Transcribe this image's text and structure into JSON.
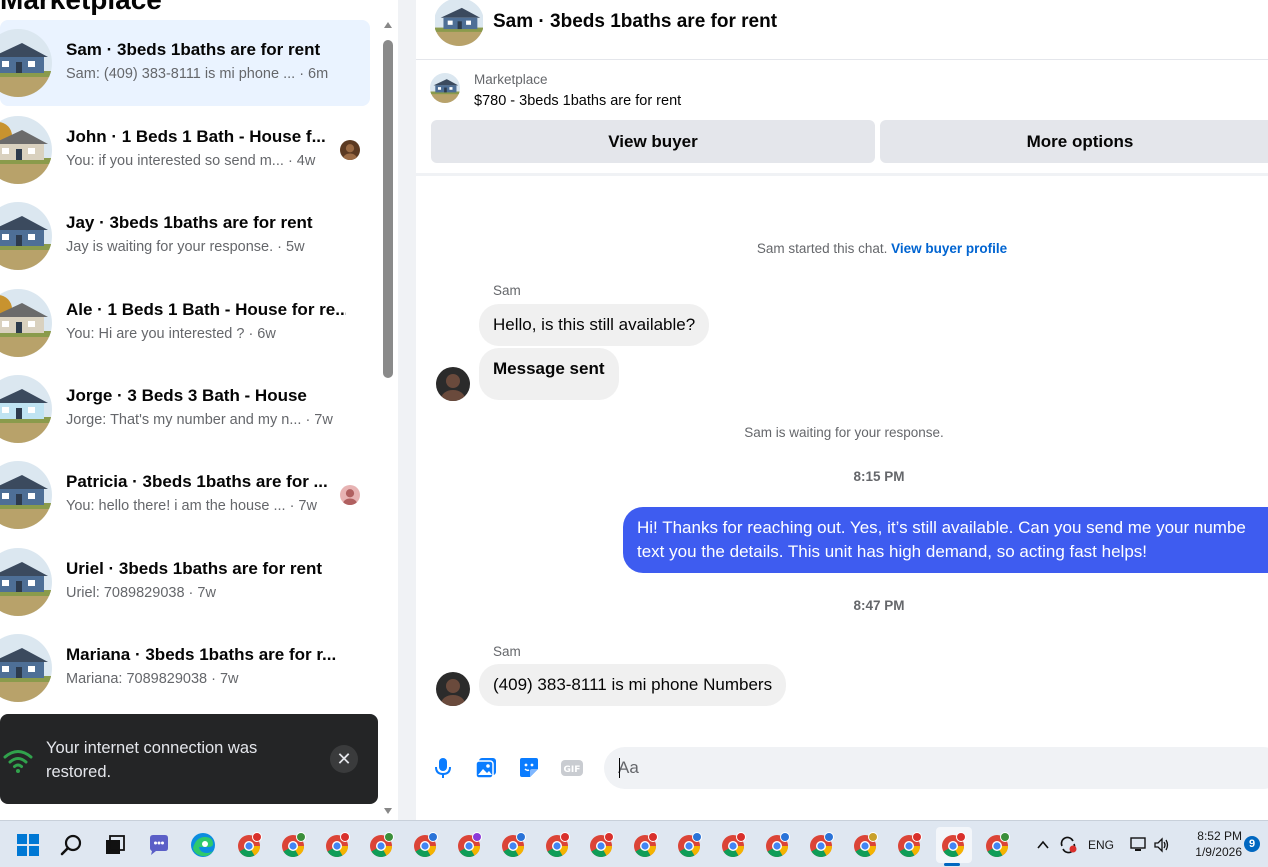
{
  "left_panel": {
    "title": "Marketplace",
    "conversations": [
      {
        "title": "Sam · 3beds 1baths are for rent",
        "preview": "Sam: (409) 383-8111 is mi phone ...",
        "time": "· 6m",
        "active": true,
        "has_avatar": false
      },
      {
        "title": "John · 1 Beds 1 Bath - House f...",
        "preview": "You: if you interested so send m...",
        "time": "· 4w",
        "active": false,
        "has_avatar": true
      },
      {
        "title": "Jay · 3beds 1baths are for rent",
        "preview": "Jay is waiting for your response.",
        "time": "· 5w",
        "active": false,
        "has_avatar": false
      },
      {
        "title": "Ale · 1 Beds 1 Bath - House for re...",
        "preview": "You: Hi are you interested ?",
        "time": "· 6w",
        "active": false,
        "has_avatar": false
      },
      {
        "title": "Jorge · 3 Beds 3 Bath - House",
        "preview": "Jorge: That's my number and my n...",
        "time": "· 7w",
        "active": false,
        "has_avatar": false
      },
      {
        "title": "Patricia · 3beds 1baths are for ...",
        "preview": "You: hello there! i am the house ...",
        "time": "· 7w",
        "active": false,
        "has_avatar": true
      },
      {
        "title": "Uriel · 3beds 1baths are for rent",
        "preview": "Uriel: 7089829038",
        "time": "· 7w",
        "active": false,
        "has_avatar": false
      },
      {
        "title": "Mariana · 3beds 1baths are for r...",
        "preview": "Mariana: 7089829038",
        "time": "· 7w",
        "active": false,
        "has_avatar": false
      }
    ],
    "toast": {
      "message": "Your internet connection was restored.",
      "close_icon": "close-icon"
    }
  },
  "chat": {
    "header_title": "Sam · 3beds 1baths are for rent",
    "listing": {
      "label": "Marketplace",
      "title": "$780 - 3beds 1baths are for rent",
      "view_buyer_label": "View buyer",
      "more_options_label": "More options"
    },
    "started_text": "Sam started this chat.",
    "view_profile_link": "View buyer profile",
    "sender_1": "Sam",
    "msg_1": "Hello, is this still available?",
    "msg_2": "Message sent",
    "waiting_text": "Sam is waiting for your response.",
    "time_1": "8:15 PM",
    "outgoing_line_1": "Hi! Thanks for reaching out. Yes, it’s still available. Can you send me your numbe",
    "outgoing_line_2": "text you the details. This unit has high demand, so acting fast helps!",
    "time_2": "8:47 PM",
    "sender_2": "Sam",
    "msg_3": "(409) 383-8111 is mi phone Numbers",
    "composer_placeholder": "Aa",
    "accent_color": "#3e5cf0",
    "link_color": "#0064d1"
  },
  "taskbar": {
    "language": "ENG",
    "time": "8:52 PM",
    "date": "1/9/2026",
    "notification_count": "9",
    "icons": [
      "start-icon",
      "search-icon",
      "task-view-icon",
      "chat-icon",
      "edge-icon",
      "chrome-icon"
    ]
  }
}
